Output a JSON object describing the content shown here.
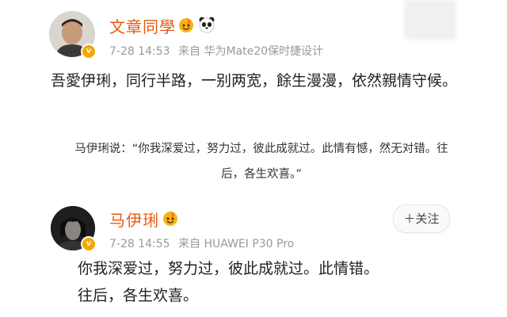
{
  "posts": [
    {
      "username": "文章同學",
      "time": "7-28 14:53",
      "source": "来自 华为Mate20保时捷设计",
      "text": "吾愛伊琍，同行半路，一别两宽，餘生漫漫，依然親情守候。",
      "badges": [
        "fire-emoji-icon",
        "panda-emoji-icon"
      ]
    },
    {
      "username": "马伊琍",
      "time": "7-28 14:55",
      "source": "来自 HUAWEI P30 Pro",
      "text": "你我深爱过，努力过，彼此成就过。此情错。往后，各生欢喜。",
      "badges": [
        "fire-emoji-icon"
      ],
      "follow_label": "＋关注"
    }
  ],
  "quote": {
    "line1": "马伊琍说：“你我深爱过，努力过，彼此成就过。此情有憾，然无对错。往",
    "line2": "后，各生欢喜。”"
  },
  "colors": {
    "username": "#e8590c",
    "meta": "#999999",
    "verified_badge": "#f7a600"
  }
}
